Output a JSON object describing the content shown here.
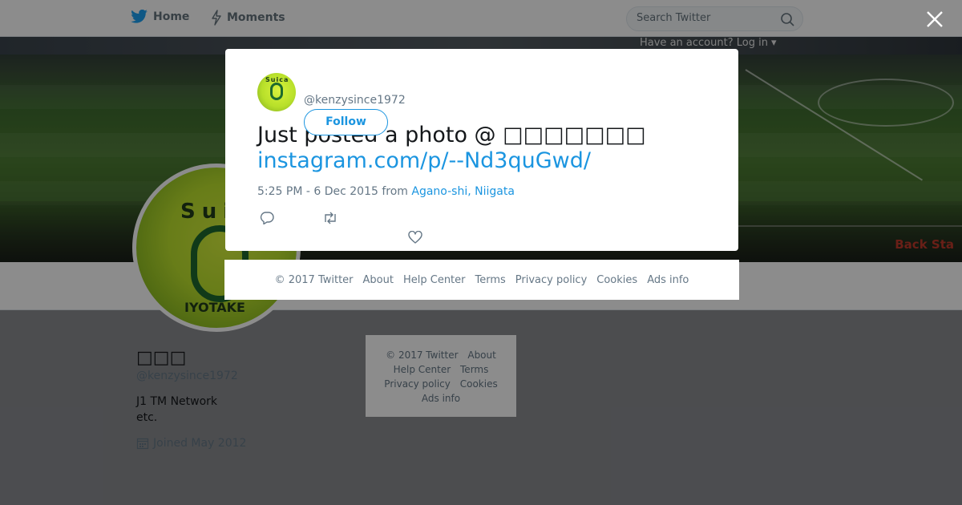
{
  "nav": {
    "home_label": "Home",
    "moments_label": "Moments",
    "search_placeholder": "Search Twitter",
    "have_account": "Have an account? Log in ▾"
  },
  "cover": {
    "sign_text": "Back Sta"
  },
  "profile": {
    "name": "□□□",
    "handle": "@kenzysince1972",
    "bio_line1": "J1  TM Network",
    "bio_line2": " etc.",
    "joined": "Joined May 2012",
    "avatar_text": "Sui",
    "avatar_name": "IYOTAKE"
  },
  "side_footer": {
    "items": [
      "© 2017 Twitter",
      "About",
      "Help Center",
      "Terms",
      "Privacy policy",
      "Cookies",
      "Ads info"
    ]
  },
  "modal": {
    "handle": "@kenzysince1972",
    "follow_label": "Follow",
    "tweet_text": "Just posted a photo @ □□□□□□□",
    "tweet_link": "instagram.com/p/--Nd3quGwd/",
    "timestamp": "5:25 PM - 6 Dec 2015",
    "from_label": "from",
    "location": "Agano-shi, Niigata",
    "avatar_text": "Suica"
  },
  "footer": {
    "items": [
      "© 2017 Twitter",
      "About",
      "Help Center",
      "Terms",
      "Privacy policy",
      "Cookies",
      "Ads info"
    ]
  },
  "colors": {
    "accent": "#1b95e0",
    "text": "#14171a",
    "muted": "#657786"
  }
}
